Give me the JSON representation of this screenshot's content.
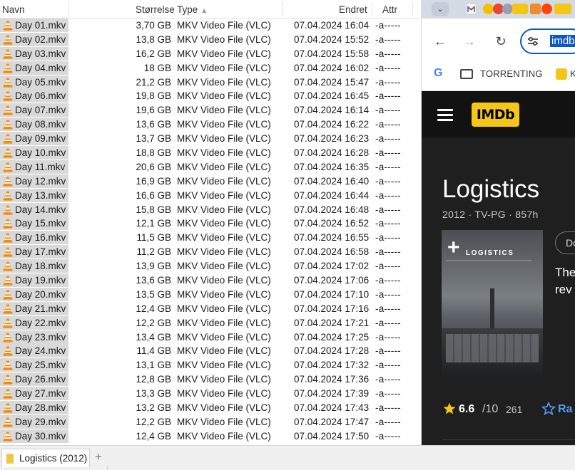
{
  "file_manager": {
    "columns": {
      "name": "Navn",
      "size": "Størrelse",
      "type": "Type",
      "modified": "Endret",
      "attr": "Attr"
    },
    "files": [
      {
        "name": "Day 01.mkv",
        "size": "3,70 GB",
        "type": "MKV Video File (VLC)",
        "modified": "07.04.2024 16:04",
        "attr": "-a-----"
      },
      {
        "name": "Day 02.mkv",
        "size": "13,8 GB",
        "type": "MKV Video File (VLC)",
        "modified": "07.04.2024 15:52",
        "attr": "-a-----"
      },
      {
        "name": "Day 03.mkv",
        "size": "16,2 GB",
        "type": "MKV Video File (VLC)",
        "modified": "07.04.2024 15:58",
        "attr": "-a-----"
      },
      {
        "name": "Day 04.mkv",
        "size": "18 GB",
        "type": "MKV Video File (VLC)",
        "modified": "07.04.2024 16:02",
        "attr": "-a-----"
      },
      {
        "name": "Day 05.mkv",
        "size": "21,2 GB",
        "type": "MKV Video File (VLC)",
        "modified": "07.04.2024 15:47",
        "attr": "-a-----"
      },
      {
        "name": "Day 06.mkv",
        "size": "19,8 GB",
        "type": "MKV Video File (VLC)",
        "modified": "07.04.2024 16:45",
        "attr": "-a-----"
      },
      {
        "name": "Day 07.mkv",
        "size": "19,6 GB",
        "type": "MKV Video File (VLC)",
        "modified": "07.04.2024 16:14",
        "attr": "-a-----"
      },
      {
        "name": "Day 08.mkv",
        "size": "13,6 GB",
        "type": "MKV Video File (VLC)",
        "modified": "07.04.2024 16:22",
        "attr": "-a-----"
      },
      {
        "name": "Day 09.mkv",
        "size": "13,7 GB",
        "type": "MKV Video File (VLC)",
        "modified": "07.04.2024 16:23",
        "attr": "-a-----"
      },
      {
        "name": "Day 10.mkv",
        "size": "18,8 GB",
        "type": "MKV Video File (VLC)",
        "modified": "07.04.2024 16:28",
        "attr": "-a-----"
      },
      {
        "name": "Day 11.mkv",
        "size": "20,6 GB",
        "type": "MKV Video File (VLC)",
        "modified": "07.04.2024 16:35",
        "attr": "-a-----"
      },
      {
        "name": "Day 12.mkv",
        "size": "16,9 GB",
        "type": "MKV Video File (VLC)",
        "modified": "07.04.2024 16:40",
        "attr": "-a-----"
      },
      {
        "name": "Day 13.mkv",
        "size": "16,6 GB",
        "type": "MKV Video File (VLC)",
        "modified": "07.04.2024 16:44",
        "attr": "-a-----"
      },
      {
        "name": "Day 14.mkv",
        "size": "15,8 GB",
        "type": "MKV Video File (VLC)",
        "modified": "07.04.2024 16:48",
        "attr": "-a-----"
      },
      {
        "name": "Day 15.mkv",
        "size": "12,1 GB",
        "type": "MKV Video File (VLC)",
        "modified": "07.04.2024 16:52",
        "attr": "-a-----"
      },
      {
        "name": "Day 16.mkv",
        "size": "11,5 GB",
        "type": "MKV Video File (VLC)",
        "modified": "07.04.2024 16:55",
        "attr": "-a-----"
      },
      {
        "name": "Day 17.mkv",
        "size": "11,2 GB",
        "type": "MKV Video File (VLC)",
        "modified": "07.04.2024 16:58",
        "attr": "-a-----"
      },
      {
        "name": "Day 18.mkv",
        "size": "13,9 GB",
        "type": "MKV Video File (VLC)",
        "modified": "07.04.2024 17:02",
        "attr": "-a-----"
      },
      {
        "name": "Day 19.mkv",
        "size": "13,6 GB",
        "type": "MKV Video File (VLC)",
        "modified": "07.04.2024 17:06",
        "attr": "-a-----"
      },
      {
        "name": "Day 20.mkv",
        "size": "13,5 GB",
        "type": "MKV Video File (VLC)",
        "modified": "07.04.2024 17:10",
        "attr": "-a-----"
      },
      {
        "name": "Day 21.mkv",
        "size": "12,4 GB",
        "type": "MKV Video File (VLC)",
        "modified": "07.04.2024 17:16",
        "attr": "-a-----"
      },
      {
        "name": "Day 22.mkv",
        "size": "12,2 GB",
        "type": "MKV Video File (VLC)",
        "modified": "07.04.2024 17:21",
        "attr": "-a-----"
      },
      {
        "name": "Day 23.mkv",
        "size": "13,4 GB",
        "type": "MKV Video File (VLC)",
        "modified": "07.04.2024 17:25",
        "attr": "-a-----"
      },
      {
        "name": "Day 24.mkv",
        "size": "11,4 GB",
        "type": "MKV Video File (VLC)",
        "modified": "07.04.2024 17:28",
        "attr": "-a-----"
      },
      {
        "name": "Day 25.mkv",
        "size": "13,1 GB",
        "type": "MKV Video File (VLC)",
        "modified": "07.04.2024 17:32",
        "attr": "-a-----"
      },
      {
        "name": "Day 26.mkv",
        "size": "12,8 GB",
        "type": "MKV Video File (VLC)",
        "modified": "07.04.2024 17:36",
        "attr": "-a-----"
      },
      {
        "name": "Day 27.mkv",
        "size": "13,3 GB",
        "type": "MKV Video File (VLC)",
        "modified": "07.04.2024 17:39",
        "attr": "-a-----"
      },
      {
        "name": "Day 28.mkv",
        "size": "13,2 GB",
        "type": "MKV Video File (VLC)",
        "modified": "07.04.2024 17:43",
        "attr": "-a-----"
      },
      {
        "name": "Day 29.mkv",
        "size": "12,2 GB",
        "type": "MKV Video File (VLC)",
        "modified": "07.04.2024 17:47",
        "attr": "-a-----"
      },
      {
        "name": "Day 30.mkv",
        "size": "12,4 GB",
        "type": "MKV Video File (VLC)",
        "modified": "07.04.2024 17:50",
        "attr": "-a-----"
      }
    ],
    "file_icon": "vlc-cone-icon",
    "tab": {
      "label": "Logistics (2012)",
      "icon": "folder-icon",
      "add_label": "+"
    }
  },
  "browser": {
    "address_text": "imdb",
    "bookmarks": {
      "folder_label": "TORRENTING",
      "trailing_label": "K"
    },
    "imdb": {
      "logo": "IMDb",
      "title": "Logistics",
      "meta": "2012 · TV-PG · 857h",
      "poster_title": "LOGISTICS",
      "poster_add": "+",
      "genre_chip": "Do",
      "plot_line1": "The",
      "plot_line2": "rev",
      "rating": "6.6",
      "rating_max": "/10",
      "rating_count": "261",
      "rate_label": "Ra"
    },
    "colors": {
      "imdb_yellow": "#f5c518",
      "accent_blue": "#0b57d0",
      "rate_blue": "#5799ef"
    }
  }
}
